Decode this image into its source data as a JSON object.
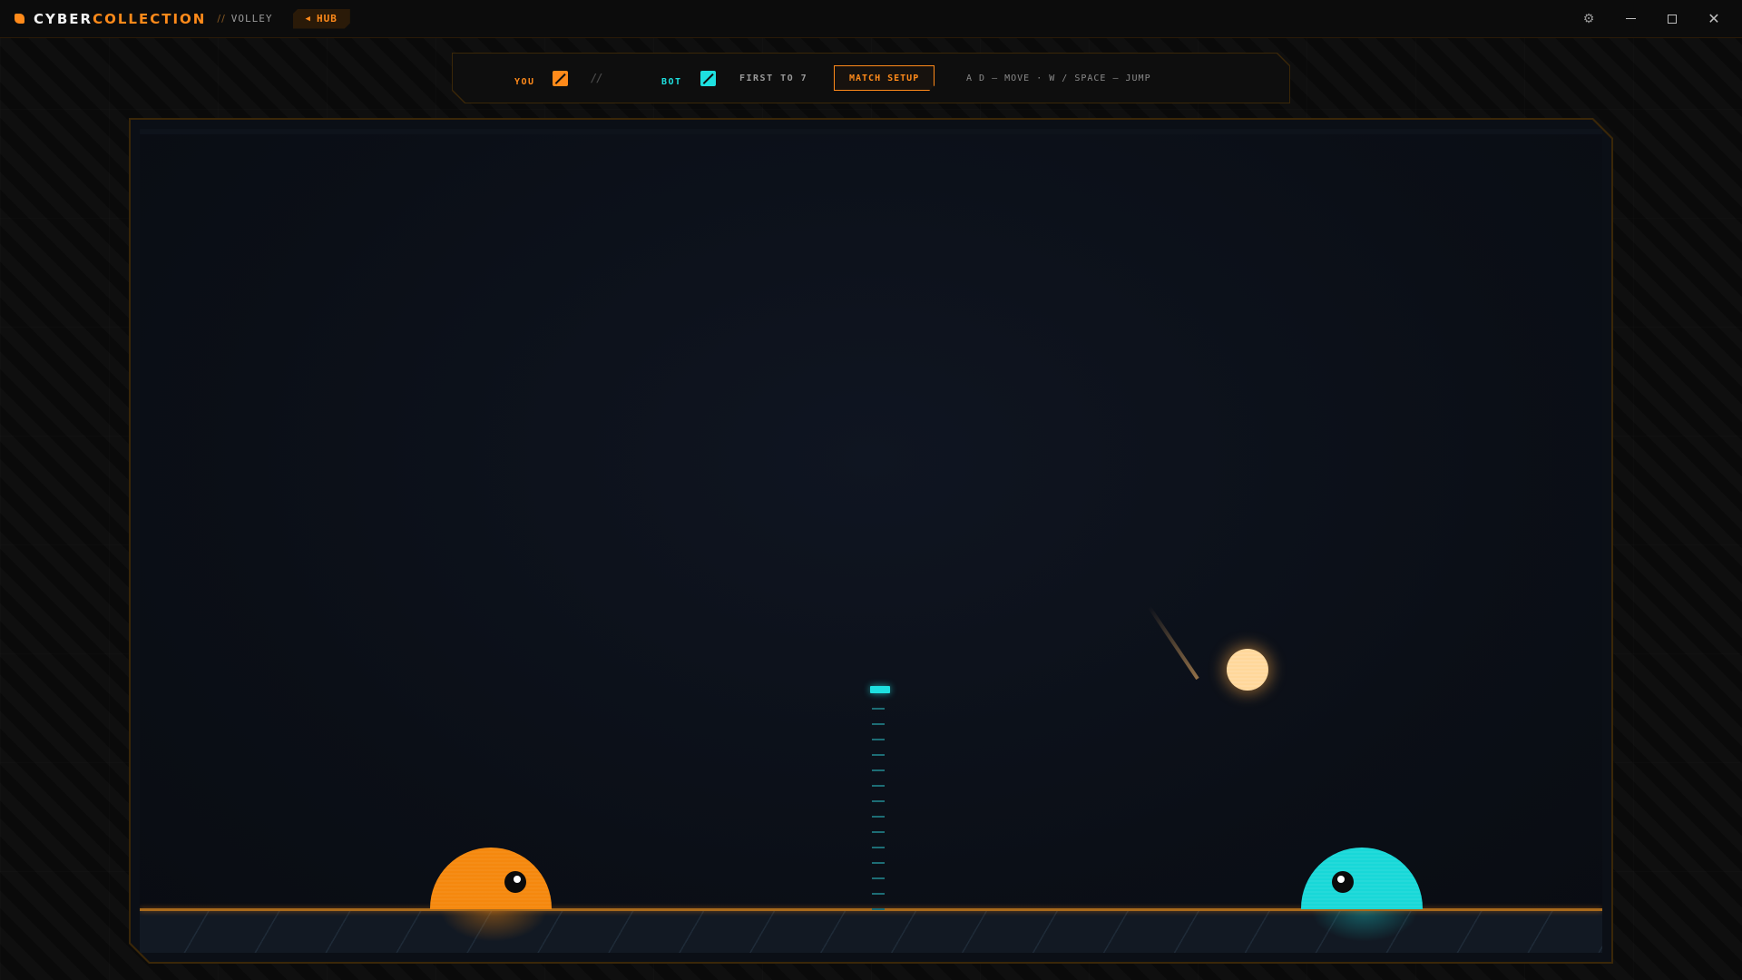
{
  "app": {
    "brand_part1": "CYBER",
    "brand_part2": "COLLECTION",
    "breadcrumb_sep": "//",
    "breadcrumb_page": "VOLLEY",
    "hub_label": "HUB",
    "hub_icon": "back-arrow-icon"
  },
  "window_controls": {
    "settings_icon": "gear-icon",
    "minimize_icon": "minimize-icon",
    "maximize_icon": "maximize-icon",
    "close_icon": "close-icon"
  },
  "hud": {
    "player_label": "YOU",
    "player_score": "0",
    "score_separator": "//",
    "bot_label": "BOT",
    "bot_score": "0",
    "first_to": "FIRST TO 7",
    "match_setup_label": "MATCH SETUP",
    "controls_hint": "A D — MOVE · W / SPACE — JUMP"
  },
  "colors": {
    "accent_orange": "#ff8a1a",
    "accent_cyan": "#1ee0e0",
    "background": "#0a0a0a",
    "court": "#0b0f16"
  }
}
